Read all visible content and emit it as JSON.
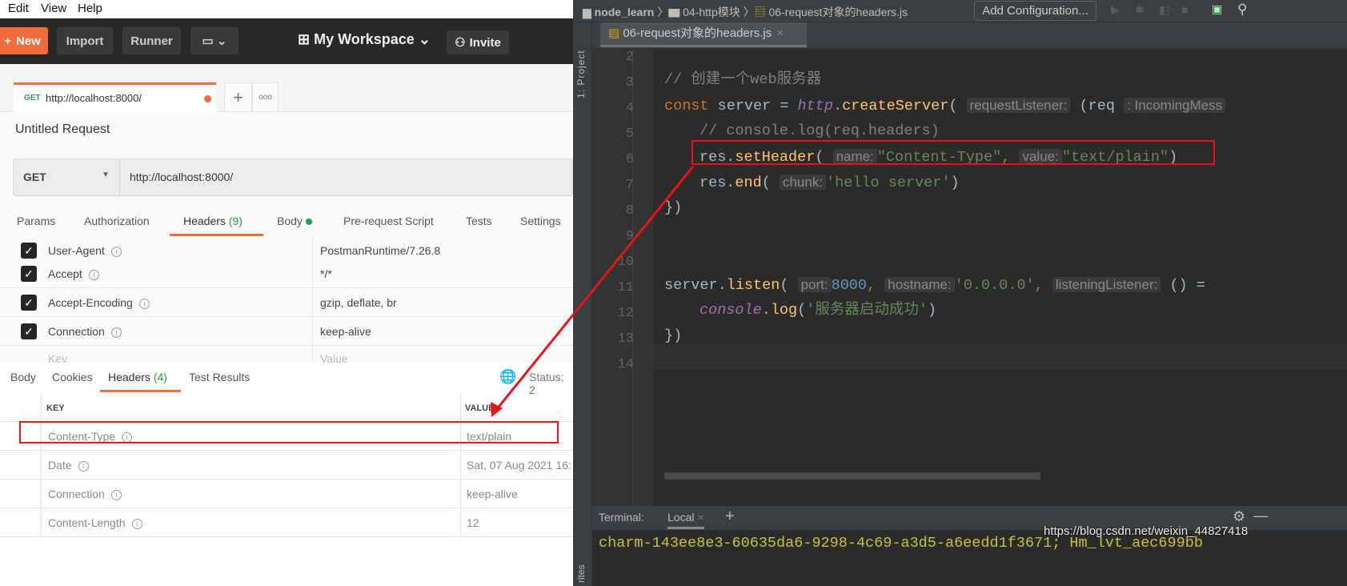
{
  "postman": {
    "menu": [
      "Edit",
      "View",
      "Help"
    ],
    "toolbar": {
      "new": "New",
      "import": "Import",
      "runner": "Runner",
      "workspace": "My Workspace",
      "invite": "Invite"
    },
    "tab": {
      "method": "GET",
      "url": "http://localhost:8000/"
    },
    "request_title": "Untitled Request",
    "method": "GET",
    "url": "http://localhost:8000/",
    "request_tabs": [
      {
        "label": "Params"
      },
      {
        "label": "Authorization"
      },
      {
        "label": "Headers",
        "count": "(9)"
      },
      {
        "label": "Body"
      },
      {
        "label": "Pre-request Script"
      },
      {
        "label": "Tests"
      },
      {
        "label": "Settings"
      }
    ],
    "request_headers": [
      {
        "key": "User-Agent",
        "value": "PostmanRuntime/7.26.8",
        "checked": true
      },
      {
        "key": "Accept",
        "value": "*/*",
        "checked": true
      },
      {
        "key": "Accept-Encoding",
        "value": "gzip, deflate, br",
        "checked": true
      },
      {
        "key": "Connection",
        "value": "keep-alive",
        "checked": true
      }
    ],
    "new_key_placeholder": "Key",
    "new_value_placeholder": "Value",
    "response_tabs": [
      {
        "label": "Body"
      },
      {
        "label": "Cookies"
      },
      {
        "label": "Headers",
        "count": "(4)"
      },
      {
        "label": "Test Results"
      }
    ],
    "status_label": "Status:",
    "status_value": "2",
    "response_columns": [
      "KEY",
      "VALUE"
    ],
    "response_headers": [
      {
        "key": "Content-Type",
        "value": "text/plain"
      },
      {
        "key": "Date",
        "value": "Sat, 07 Aug 2021 16:"
      },
      {
        "key": "Connection",
        "value": "keep-alive"
      },
      {
        "key": "Content-Length",
        "value": "12"
      }
    ],
    "accent": "#f26b3a"
  },
  "ide": {
    "breadcrumb": [
      "node_learn",
      "04-http模块",
      "06-request对象的headers.js"
    ],
    "add_config": "Add Configuration...",
    "side_label": "1: Project",
    "file_tab": "06-request对象的headers.js",
    "lines": {
      "n": [
        "2",
        "3",
        "4",
        "5",
        "6",
        "7",
        "8",
        "9",
        "10",
        "11",
        "12",
        "13",
        "14"
      ],
      "l3": "// 创建一个web服务器",
      "l4a": "const",
      "l4b": " server = ",
      "l4c": "http",
      "l4d": ".",
      "l4e": "createServer",
      "l4f": "(",
      "l4h1": "requestListener:",
      "l4g": "(req",
      "l4h2": ": IncomingMess",
      "l5": "// console.log(req.headers)",
      "l6a": "res.",
      "l6b": "setHeader",
      "l6c": "(",
      "l6h1": "name:",
      "l6d": "\"Content-Type\"",
      "l6e": ",",
      "l6h2": "value:",
      "l6f": "\"text/plain\"",
      "l6g": ")",
      "l7a": "res.",
      "l7b": "end",
      "l7c": "(",
      "l7h": "chunk:",
      "l7d": "'hello server'",
      "l7e": ")",
      "l8": "})",
      "l11a": "server.",
      "l11b": "listen",
      "l11c": "(",
      "l11h1": "port:",
      "l11d": "8000",
      "l11e": ",",
      "l11h2": "hostname:",
      "l11f": "'0.0.0.0'",
      "l11g": ",",
      "l11h3": "listeningListener:",
      "l11i": "() =",
      "l12a": "console",
      "l12b": ".",
      "l12c": "log",
      "l12d": "(",
      "l12e": "'服务器启动成功'",
      "l12f": ")",
      "l13": "})"
    },
    "terminal_label": "Terminal:",
    "terminal_tab": "Local",
    "terminal_output": "charm-143ee8e3-60635da6-9298-4c69-a3d5-a6eedd1f3671; Hm_lvt_aec699bb",
    "watermark": "https://blog.csdn.net/weixin_44827418",
    "favorites_label": "rites"
  }
}
